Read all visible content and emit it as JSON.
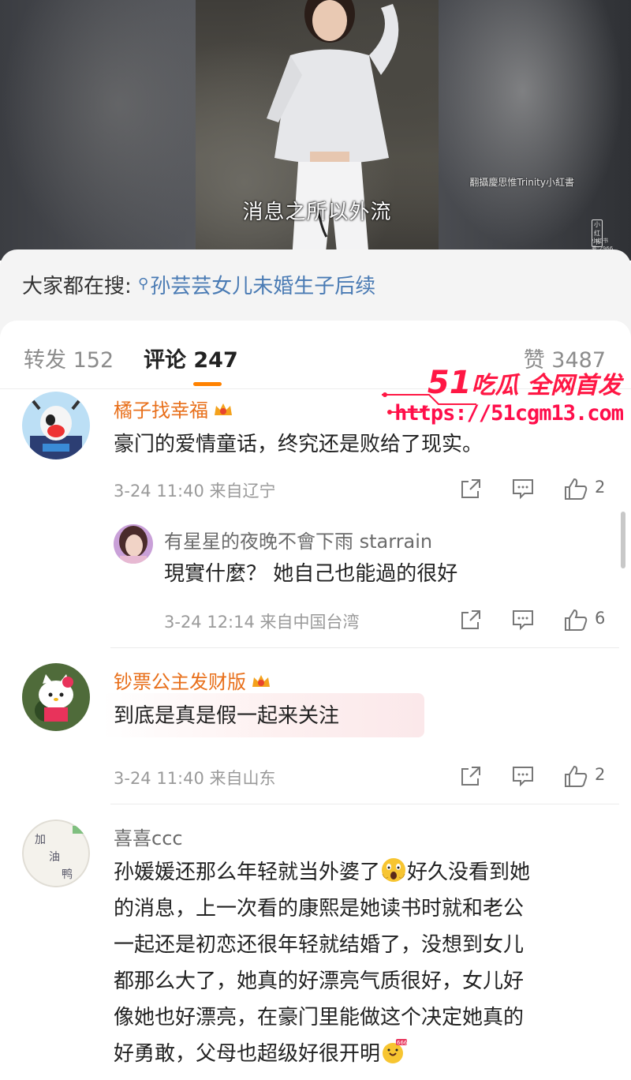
{
  "video": {
    "caption": "消息之所以外流",
    "watermark": "翻攝慶思惟Trinity小紅書",
    "tag": "小红书",
    "tag_sub": "小红书号:2966"
  },
  "search": {
    "prefix": "大家都在搜: ",
    "icon": "search-icon",
    "query": "孙芸芸女儿未婚生子后续"
  },
  "tabs": {
    "repost": "转发 152",
    "comment": "评论 247",
    "like": "赞 3487"
  },
  "promo": {
    "brand_num": "51",
    "brand_text": "吃瓜 全网首发",
    "url": "https://51cgm13.com"
  },
  "comments": [
    {
      "name": "橘子找幸福",
      "text": "豪门的爱情童话，终究还是败给了现实。",
      "meta": "3-24 11:40  来自辽宁",
      "likes": "2",
      "reply": {
        "name": "有星星的夜晚不會下雨 starrain",
        "text": "現實什麼？ 她自己也能過的很好",
        "meta": "3-24 12:14  来自中国台湾",
        "likes": "6"
      }
    },
    {
      "name": "钞票公主发财版",
      "text": "到底是真是假一起来关注",
      "meta": "3-24 11:40  来自山东",
      "likes": "2"
    },
    {
      "name": "喜喜ccc",
      "text_lines": [
        "孙媛媛还那么年轻就当外婆了",
        "好久没看到她",
        "的消息，上一次看的康熙是她读书时就和老公",
        "一起还是初恋还很年轻就结婚了，没想到女儿",
        "都那么大了，她真的好漂亮气质很好，女儿好",
        "像她也好漂亮，在豪门里能做这个决定她真的",
        "好勇敢，父母也超级好很开明"
      ]
    }
  ],
  "colors": {
    "accent": "#ff8200",
    "link": "#4a7bb4",
    "vip_name": "#e86f1a",
    "promo": "#ff1744"
  }
}
